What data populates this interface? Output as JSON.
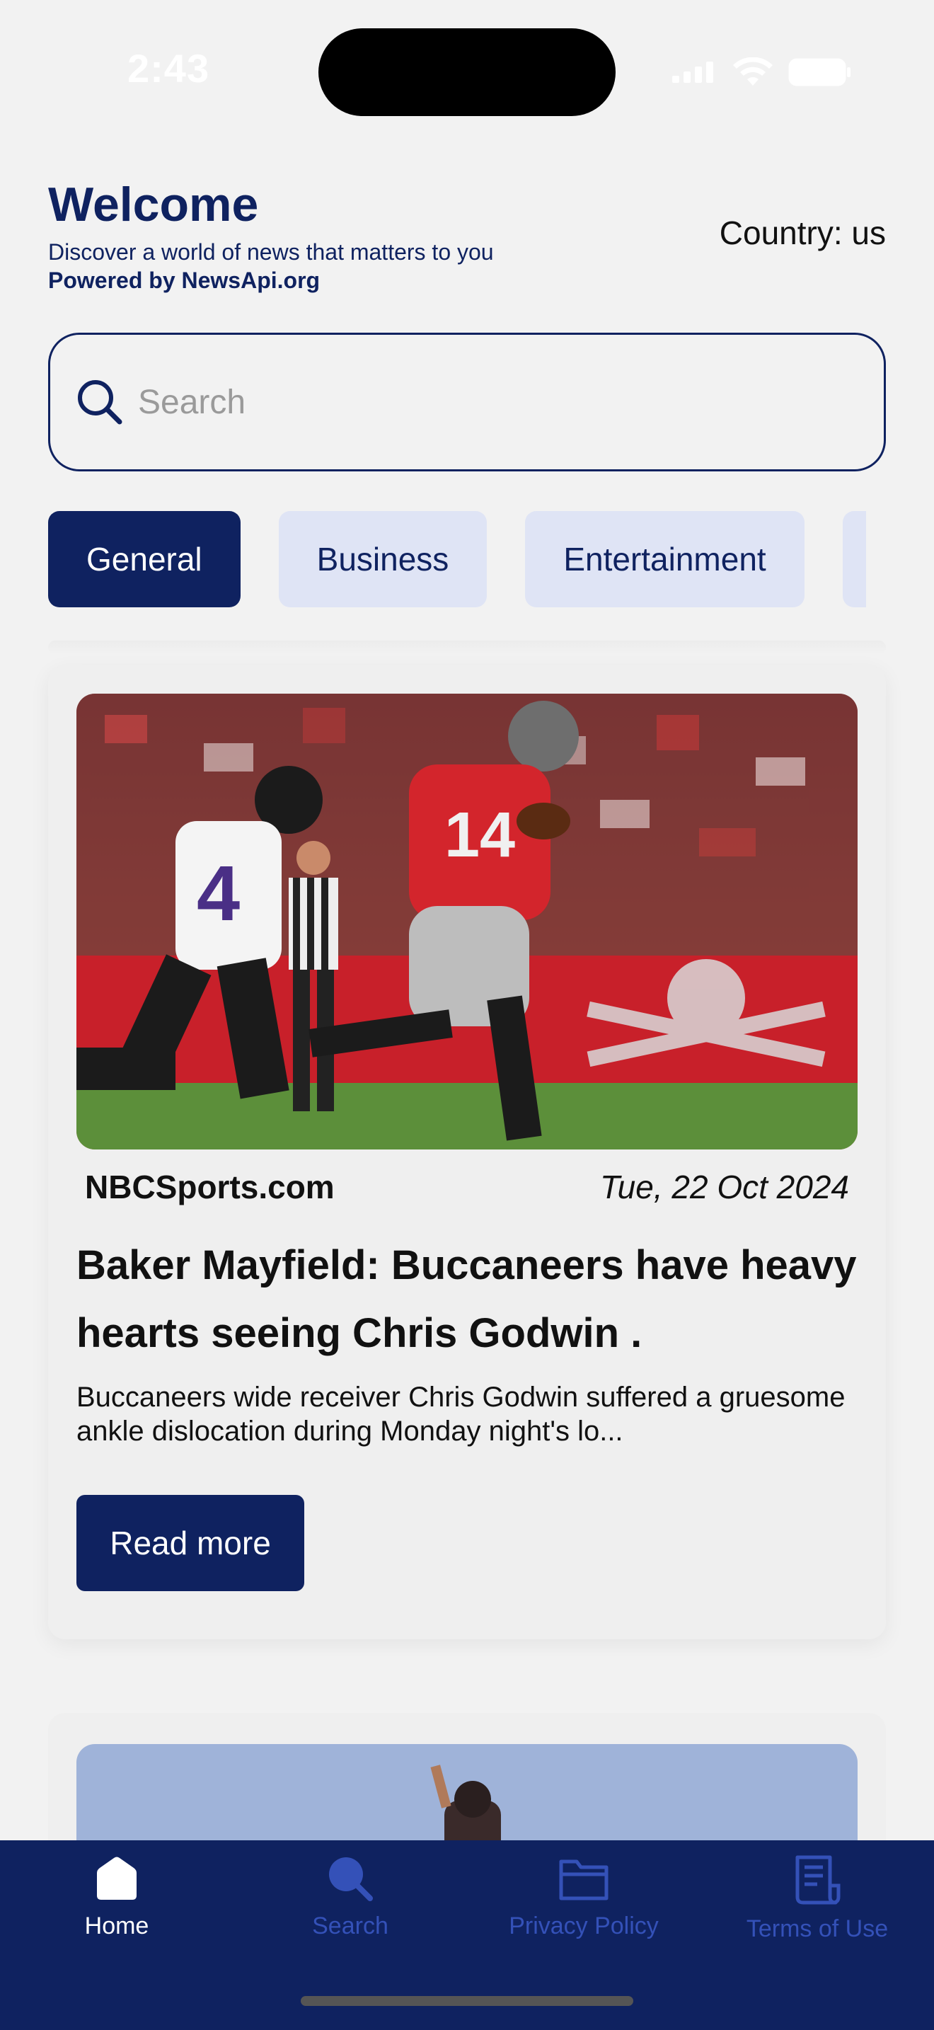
{
  "status_bar": {
    "time": "2:43"
  },
  "header": {
    "title": "Welcome",
    "subtitle": "Discover a world of news that matters to you",
    "powered_by": "Powered by NewsApi.org",
    "country": "Country: us"
  },
  "search": {
    "placeholder": "Search",
    "value": ""
  },
  "categories": {
    "items": [
      {
        "label": "General",
        "active": true
      },
      {
        "label": "Business",
        "active": false
      },
      {
        "label": "Entertainment",
        "active": false
      },
      {
        "label": "",
        "active": false
      }
    ]
  },
  "articles": [
    {
      "source": "NBCSports.com",
      "date": "Tue, 22 Oct 2024",
      "headline": "Baker Mayfield: Buccaneers have heavy hearts seeing Chris Godwin .",
      "description": "Buccaneers wide receiver Chris Godwin suffered a gruesome ankle dislocation during Monday night's lo...",
      "read_more_label": "Read more",
      "image_icon": "football-photo"
    },
    {
      "image_icon": "baseball-photo"
    }
  ],
  "tabbar": {
    "items": [
      {
        "label": "Home",
        "icon": "home-icon",
        "active": true
      },
      {
        "label": "Search",
        "icon": "search-icon",
        "active": false
      },
      {
        "label": "Privacy Policy",
        "icon": "folder-icon",
        "active": false
      },
      {
        "label": "Terms of Use",
        "icon": "document-icon",
        "active": false
      }
    ]
  },
  "colors": {
    "primary": "#0f2260",
    "chip_inactive": "#dfe4f5",
    "tab_inactive": "#3451b8",
    "background": "#f2f2f2"
  }
}
